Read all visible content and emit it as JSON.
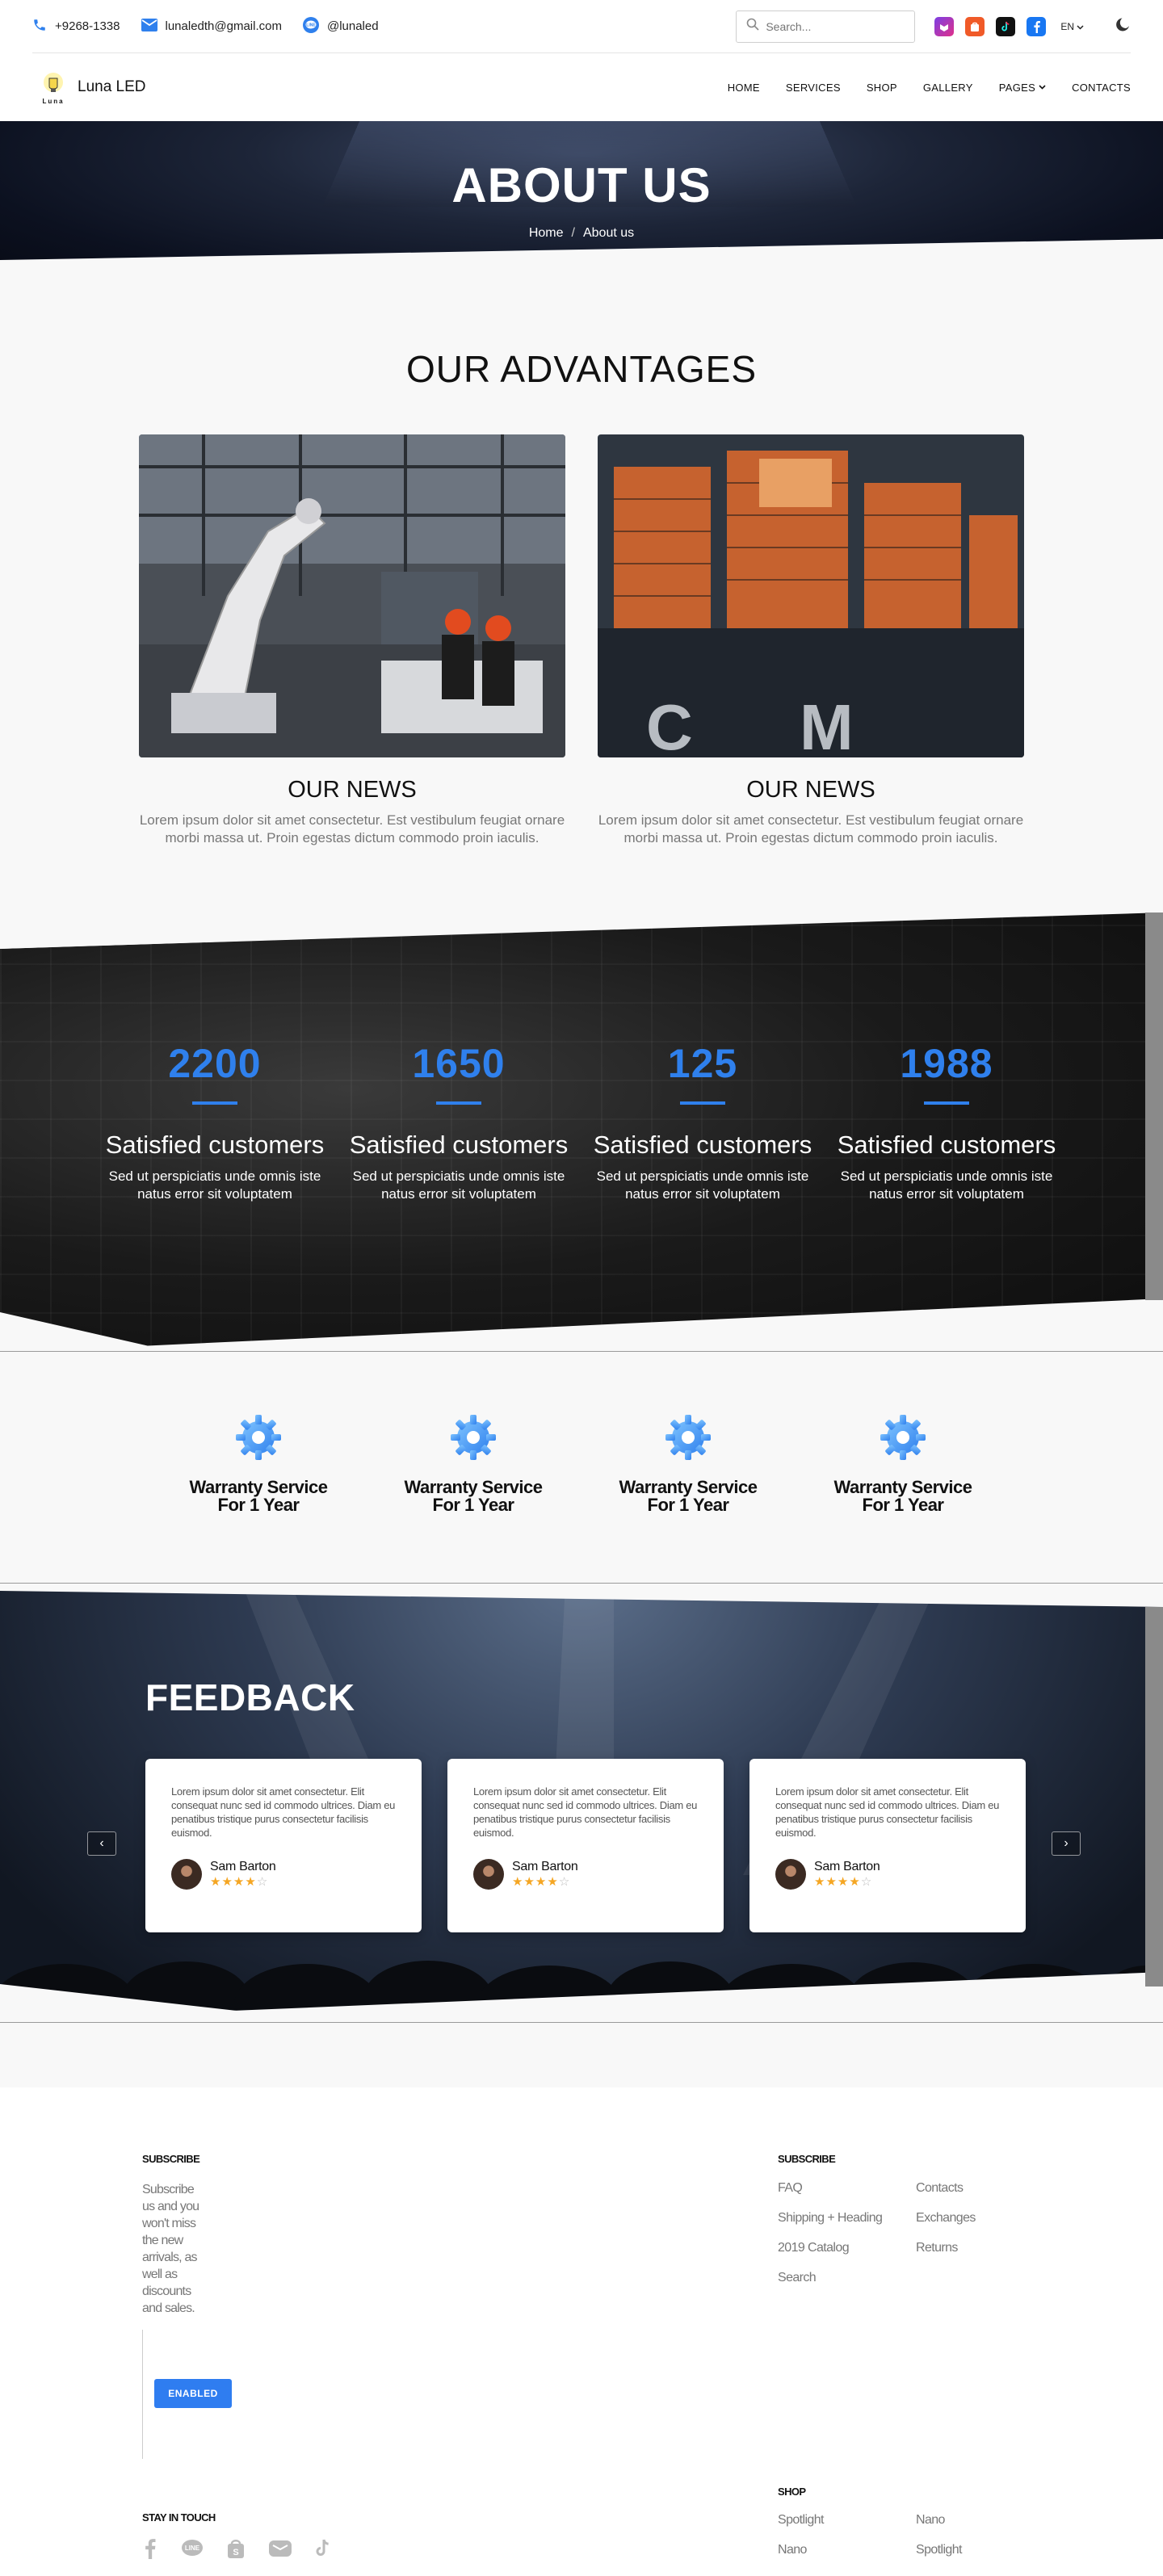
{
  "topbar": {
    "phone": "+9268-1338",
    "email": "lunaledth@gmail.com",
    "line": "@lunaled",
    "search_placeholder": "Search...",
    "lang": "EN"
  },
  "nav": {
    "brand": "Luna LED",
    "logo_text": "Luna",
    "links": [
      "HOME",
      "SERVICES",
      "SHOP",
      "GALLERY",
      "PAGES",
      "CONTACTS"
    ]
  },
  "hero": {
    "title": "ABOUT US",
    "breadcrumb_home": "Home",
    "breadcrumb_sep": "/",
    "breadcrumb_current": "About us"
  },
  "advantages": {
    "title": "OUR ADVANTAGES",
    "cards": [
      {
        "heading": "OUR NEWS",
        "text": "Lorem ipsum dolor sit amet consectetur. Est vestibulum feugiat ornare morbi massa ut. Proin egestas dictum commodo proin iaculis.",
        "image": "factory-robot-arm"
      },
      {
        "heading": "OUR NEWS",
        "text": "Lorem ipsum dolor sit amet consectetur. Est vestibulum feugiat ornare morbi massa ut. Proin egestas dictum commodo proin iaculis.",
        "image": "container-ship"
      }
    ]
  },
  "stats": [
    {
      "number": "2200",
      "heading": "Satisfied customers",
      "text": "Sed ut perspiciatis unde omnis iste natus error sit voluptatem"
    },
    {
      "number": "1650",
      "heading": "Satisfied customers",
      "text": "Sed ut perspiciatis unde omnis iste natus error sit voluptatem"
    },
    {
      "number": "125",
      "heading": "Satisfied customers",
      "text": "Sed ut perspiciatis unde omnis iste natus error sit voluptatem"
    },
    {
      "number": "1988",
      "heading": "Satisfied customers",
      "text": "Sed ut perspiciatis unde omnis iste natus error sit voluptatem"
    }
  ],
  "warranty": [
    {
      "line1": "Warranty Service",
      "line2": "For 1 Year",
      "icon": "gear-icon"
    },
    {
      "line1": "Warranty Service",
      "line2": "For 1 Year",
      "icon": "gear-icon"
    },
    {
      "line1": "Warranty Service",
      "line2": "For 1 Year",
      "icon": "gear-icon"
    },
    {
      "line1": "Warranty Service",
      "line2": "For 1 Year",
      "icon": "gear-icon"
    }
  ],
  "feedback": {
    "title": "FEEDBACK",
    "prev": "‹",
    "next": "›",
    "cards": [
      {
        "text": "Lorem ipsum dolor sit amet consectetur. Elit consequat nunc sed id commodo ultrices. Diam eu penatibus tristique purus consectetur facilisis euismod.",
        "name": "Sam Barton",
        "rating": 4,
        "max": 5
      },
      {
        "text": "Lorem ipsum dolor sit amet consectetur. Elit consequat nunc sed id commodo ultrices. Diam eu penatibus tristique purus consectetur facilisis euismod.",
        "name": "Sam Barton",
        "rating": 4,
        "max": 5
      },
      {
        "text": "Lorem ipsum dolor sit amet consectetur. Elit consequat nunc sed id commodo ultrices. Diam eu penatibus tristique purus consectetur facilisis euismod.",
        "name": "Sam Barton",
        "rating": 4,
        "max": 5
      }
    ]
  },
  "footer": {
    "subscribe_heading": "SUBSCRIBE",
    "subscribe_text": "Subscribe us and you won't miss the new arrivals, as well as discounts and sales.",
    "button": "ENABLED",
    "links_heading": "SUBSCRIBE",
    "links_col1": [
      "FAQ",
      "Shipping + Heading",
      "2019 Catalog",
      "Search"
    ],
    "links_col2": [
      "Contacts",
      "Exchanges",
      "Returns"
    ],
    "shop_heading": "SHOP",
    "shop_col1": [
      "Spotlight",
      "Nano"
    ],
    "shop_col2": [
      "Nano",
      "Spotlight"
    ],
    "stay_heading": "STAY IN TOUCH",
    "social_icons": [
      "facebook-icon",
      "line-icon",
      "shopee-icon",
      "lazada-icon",
      "tiktok-icon"
    ]
  },
  "colors": {
    "accent": "#2f80ed",
    "star": "#f5a623"
  }
}
